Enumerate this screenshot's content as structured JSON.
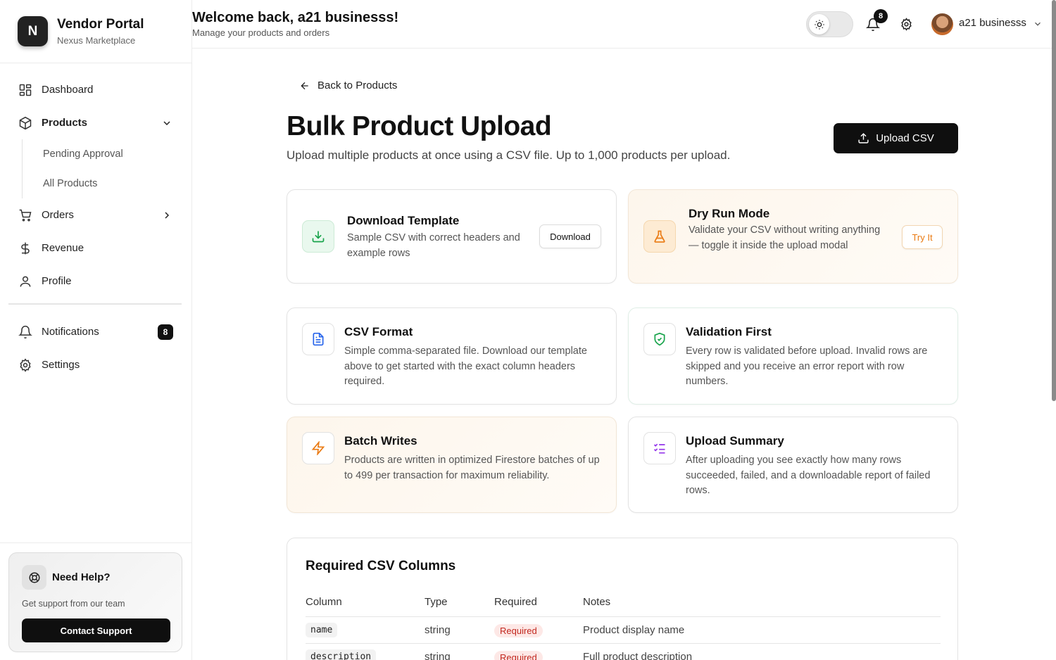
{
  "brand": {
    "logo_letter": "N",
    "title": "Vendor Portal",
    "subtitle": "Nexus Marketplace"
  },
  "sidebar": {
    "items": [
      {
        "label": "Dashboard"
      },
      {
        "label": "Products"
      },
      {
        "label": "Orders"
      },
      {
        "label": "Revenue"
      },
      {
        "label": "Profile"
      }
    ],
    "products_sub": [
      "Pending Approval",
      "All Products"
    ],
    "secondary": [
      {
        "label": "Notifications",
        "badge": "8"
      },
      {
        "label": "Settings"
      }
    ],
    "help": {
      "title": "Need Help?",
      "subtitle": "Get support from our team",
      "button": "Contact Support"
    }
  },
  "header": {
    "welcome": "Welcome back, a21 businesss!",
    "subtitle": "Manage your products and orders",
    "notification_count": "8",
    "user_name": "a21 businesss"
  },
  "main": {
    "back_label": "Back to Products",
    "title": "Bulk Product Upload",
    "subtitle": "Upload multiple products at once using a CSV file. Up to 1,000 products per upload.",
    "upload_button": "Upload CSV",
    "cards": [
      {
        "title": "Download Template",
        "desc": "Sample CSV with correct headers and example rows",
        "button": "Download",
        "icon": "download-icon"
      },
      {
        "title": "Dry Run Mode",
        "desc": "Validate your CSV without writing anything — toggle it inside the upload modal",
        "button": "Try It",
        "icon": "flask-icon"
      },
      {
        "title": "CSV Format",
        "desc": "Simple comma-separated file. Download our template above to get started with the exact column headers required.",
        "icon": "file-text-icon"
      },
      {
        "title": "Validation First",
        "desc": "Every row is validated before upload. Invalid rows are skipped and you receive an error report with row numbers.",
        "icon": "shield-check-icon"
      },
      {
        "title": "Batch Writes",
        "desc": "Products are written in optimized Firestore batches of up to 499 per transaction for maximum reliability.",
        "icon": "zap-icon"
      },
      {
        "title": "Upload Summary",
        "desc": "After uploading you see exactly how many rows succeeded, failed, and a downloadable report of failed rows.",
        "icon": "list-checks-icon"
      }
    ],
    "table": {
      "title": "Required CSV Columns",
      "headers": [
        "Column",
        "Type",
        "Required",
        "Notes"
      ],
      "rows": [
        {
          "column": "name",
          "type": "string",
          "required": "Required",
          "notes": "Product display name"
        },
        {
          "column": "description",
          "type": "string",
          "required": "Required",
          "notes": "Full product description"
        }
      ]
    }
  },
  "colors": {
    "accent_dark": "#0f0f0f",
    "green": "#16a34a",
    "orange": "#ea7a12",
    "blue": "#2563eb",
    "purple": "#9333ea",
    "required_red": "#c2281f"
  }
}
